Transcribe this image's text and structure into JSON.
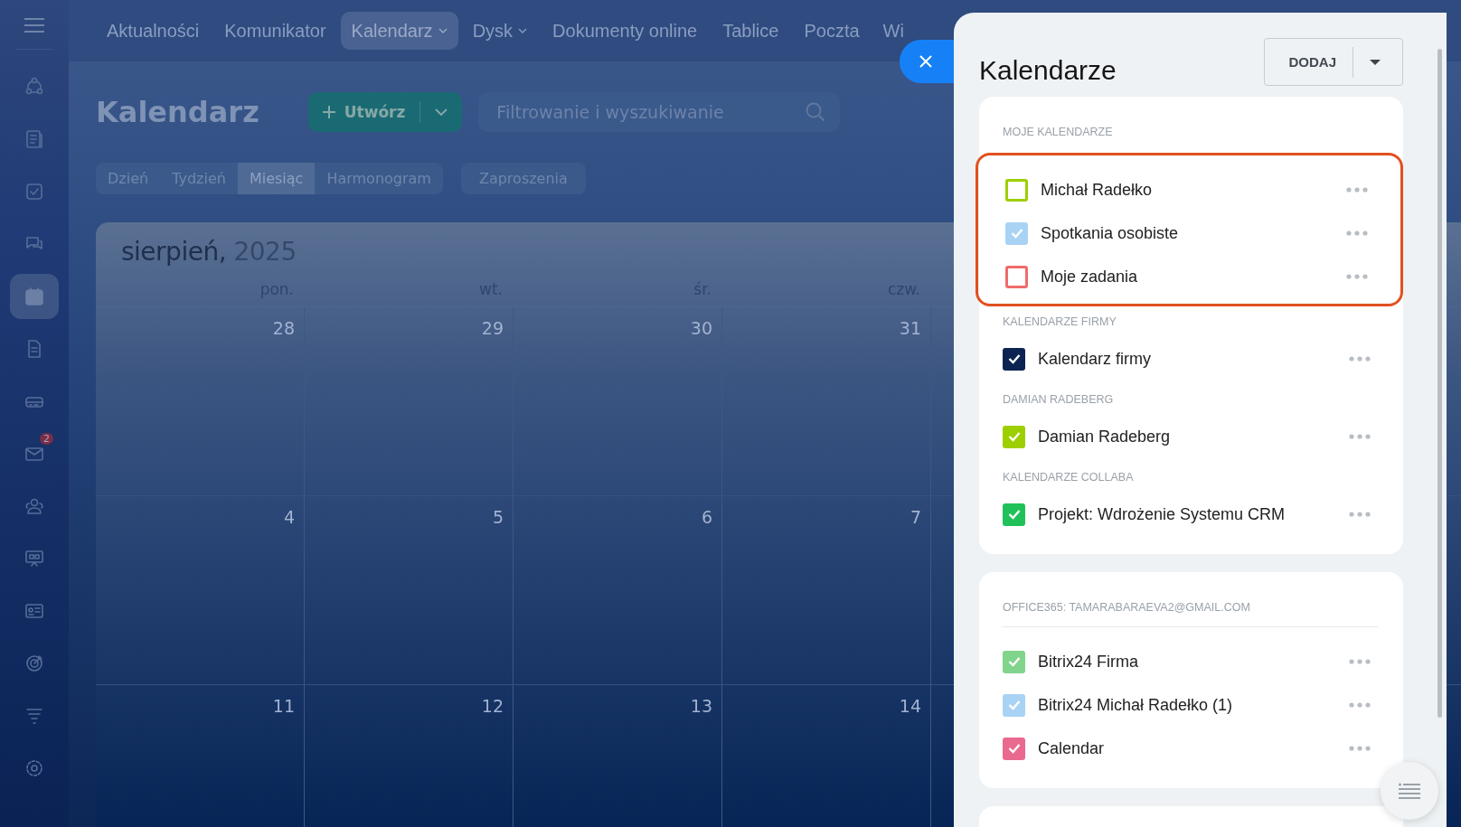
{
  "top_nav": [
    {
      "label": "Aktualności",
      "selected": false,
      "dropdown": false
    },
    {
      "label": "Komunikator",
      "selected": false,
      "dropdown": false
    },
    {
      "label": "Kalendarz",
      "selected": true,
      "dropdown": true
    },
    {
      "label": "Dysk",
      "selected": false,
      "dropdown": true
    },
    {
      "label": "Dokumenty online",
      "selected": false,
      "dropdown": false
    },
    {
      "label": "Tablice",
      "selected": false,
      "dropdown": false
    },
    {
      "label": "Poczta",
      "selected": false,
      "dropdown": false
    },
    {
      "label": "Wi",
      "selected": false,
      "dropdown": false
    }
  ],
  "sidebar": {
    "items": [
      {
        "selected": false
      },
      {
        "selected": false
      },
      {
        "selected": false
      },
      {
        "selected": false
      },
      {
        "selected": true
      },
      {
        "selected": false
      },
      {
        "selected": false
      },
      {
        "selected": false,
        "badge": "2"
      },
      {
        "selected": false
      },
      {
        "selected": false
      },
      {
        "selected": false
      },
      {
        "selected": false
      },
      {
        "selected": false
      },
      {
        "selected": false
      }
    ]
  },
  "page": {
    "title": "Kalendarz",
    "create_button": "Utwórz",
    "search": {
      "placeholder": "Filtrowanie i wyszukiwanie"
    }
  },
  "view_tabs": [
    {
      "label": "Dzień",
      "selected": false
    },
    {
      "label": "Tydzień",
      "selected": false
    },
    {
      "label": "Miesiąc",
      "selected": true
    },
    {
      "label": "Harmonogram",
      "selected": false
    }
  ],
  "invitations_tab": "Zaproszenia",
  "calendar": {
    "month": "sierpień,",
    "year": "2025",
    "weekdays": [
      "pon.",
      "wt.",
      "śr.",
      "czw."
    ],
    "weeks": [
      [
        "28",
        "29",
        "30",
        "31"
      ],
      [
        "4",
        "5",
        "6",
        "7"
      ],
      [
        "11",
        "12",
        "13",
        "14"
      ]
    ]
  },
  "panel": {
    "title": "Kalendarze",
    "add_button": "DODAJ",
    "cards": [
      {
        "sections": [
          {
            "heading": "MOJE KALENDARZE",
            "highlighted": true,
            "items": [
              {
                "label": "Michał Radełko",
                "checked": false,
                "color": "#9dcf00"
              },
              {
                "label": "Spotkania osobiste",
                "checked": true,
                "color": "#a9d3f5"
              },
              {
                "label": "Moje zadania",
                "checked": false,
                "color": "#f06b6b"
              }
            ]
          },
          {
            "heading": "KALENDARZE FIRMY",
            "highlighted": false,
            "items": [
              {
                "label": "Kalendarz firmy",
                "checked": true,
                "color": "#0b2452"
              }
            ]
          },
          {
            "heading": "DAMIAN RADEBERG",
            "highlighted": false,
            "items": [
              {
                "label": "Damian Radeberg",
                "checked": true,
                "color": "#9dcf00"
              }
            ]
          },
          {
            "heading": "KALENDARZE COLLABA",
            "highlighted": false,
            "items": [
              {
                "label": "Projekt: Wdrożenie Systemu CRM",
                "checked": true,
                "color": "#21c15a"
              }
            ]
          }
        ]
      },
      {
        "sections": [
          {
            "heading": "OFFICE365: TAMARABARAEVA2@GMAIL.COM",
            "highlighted": false,
            "divider": true,
            "items": [
              {
                "label": "Bitrix24 Firma",
                "checked": true,
                "color": "#80d48c"
              },
              {
                "label": "Bitrix24 Michał Radełko (1)",
                "checked": true,
                "color": "#a9d3f5"
              },
              {
                "label": "Calendar",
                "checked": true,
                "color": "#e9698f"
              }
            ]
          }
        ]
      }
    ]
  }
}
